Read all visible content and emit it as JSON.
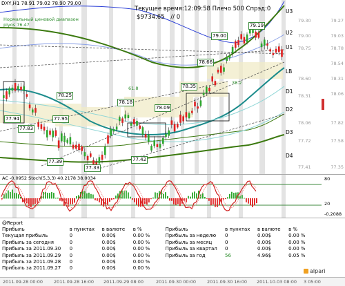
{
  "header": {
    "symbol_line": "DXY,H1  78.91 79.02 78.90 79.00",
    "indicator_name": "Нормальный ценовой диапазон",
    "indicator_value": "piyos 76.47",
    "server_time": "Текущее время:12:09:58 Плечо 500 Спрэд:0",
    "balance": "$9734.65",
    "balance_suffix": "// 0"
  },
  "levels": [
    {
      "name": "U3",
      "value": "79.30"
    },
    {
      "name": "U2",
      "value": "79.00"
    },
    {
      "name": "U1",
      "value": "78.75"
    },
    {
      "name": "LB",
      "value": "78.60"
    },
    {
      "name": "D1",
      "value": "78.31"
    },
    {
      "name": "D2",
      "value": "78.06"
    },
    {
      "name": "D3",
      "value": "77.72"
    },
    {
      "name": "D4",
      "value": "77.41"
    }
  ],
  "price_boxes": [
    "79.19",
    "79.00",
    "78.66",
    "78.35",
    "78.25",
    "78.18",
    "78.09",
    "77.94",
    "77.95",
    "77.83",
    "77.39",
    "77.33",
    "77.42"
  ],
  "fib_labels": [
    "61.8",
    "38.2"
  ],
  "price_axis": [
    "79.27",
    "79.03",
    "78.78",
    "78.54",
    "78.31",
    "78.06",
    "77.82",
    "77.58",
    "77.35"
  ],
  "current_price": "79.00",
  "oscillator": {
    "label": "AC -0.0952  Stoch(5,3,3) 40.2178 38.0034",
    "axis": [
      "80",
      "20",
      "-0.2088"
    ]
  },
  "report": {
    "title": "@Report",
    "headers_left": [
      "Прибыль",
      "в пунктах",
      "в валюте",
      "в %"
    ],
    "headers_right": [
      "Прибыль",
      "в пунктах",
      "в валюте",
      "в %"
    ],
    "rows_left": [
      [
        "Текущая прибыль",
        "0",
        "0.00$",
        "0.00 %"
      ],
      [
        "Прибыль за сегодня",
        "0",
        "0.00$",
        "0.00 %"
      ],
      [
        "Прибыль за 2011.09.30",
        "0",
        "0.00$",
        "0.00 %"
      ],
      [
        "Прибыль за 2011.09.29",
        "0",
        "0.00$",
        "0.00 %"
      ],
      [
        "Прибыль за 2011.09.28",
        "0",
        "0.00$",
        "0.00 %"
      ],
      [
        "Прибыль за 2011.09.27",
        "0",
        "0.00$",
        "0.00 %"
      ]
    ],
    "rows_right": [
      [
        "Прибыль за неделю",
        "0",
        "0.00$",
        "0.00 %"
      ],
      [
        "Прибыль за месяц",
        "0",
        "0.00$",
        "0.00 %"
      ],
      [
        "Прибыль за квартал",
        "0",
        "0.00$",
        "0.00 %"
      ],
      [
        "Прибыль за год",
        "56",
        "4.96$",
        "0.05 %"
      ]
    ],
    "brand": "alpari"
  },
  "time_axis": [
    "2011.09.28 00:00",
    "2011.09.28 16:00",
    "2011.09.29 08:00",
    "2011.09.30 00:00",
    "2011.09.30 16:00",
    "2011.10.03 08:00",
    "3 05:00"
  ]
}
